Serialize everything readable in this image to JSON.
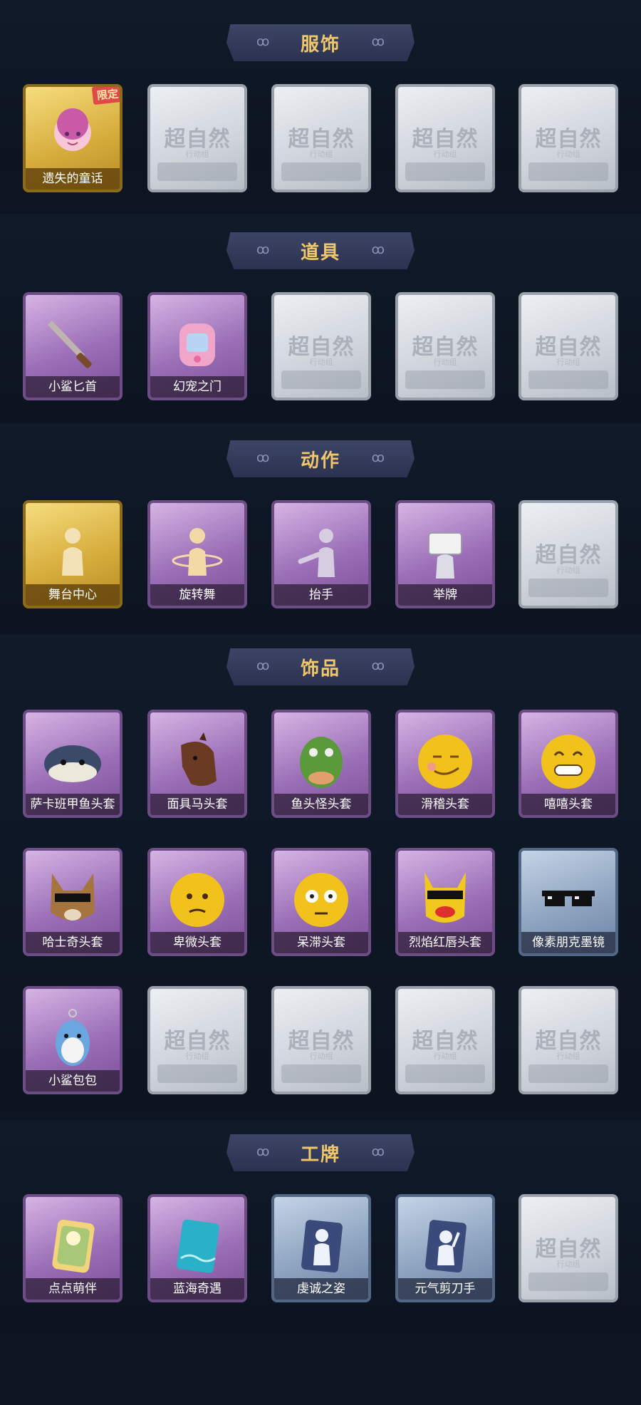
{
  "sections": [
    {
      "title": "服饰",
      "items": [
        {
          "label": "遗失的童话",
          "type": "gold",
          "badge": "限定"
        },
        {
          "empty": true
        },
        {
          "empty": true
        },
        {
          "empty": true
        },
        {
          "empty": true
        }
      ]
    },
    {
      "title": "道具",
      "items": [
        {
          "label": "小鲨匕首",
          "type": "purple"
        },
        {
          "label": "幻宠之门",
          "type": "purple"
        },
        {
          "empty": true
        },
        {
          "empty": true
        },
        {
          "empty": true
        }
      ]
    },
    {
      "title": "动作",
      "items": [
        {
          "label": "舞台中心",
          "type": "gold"
        },
        {
          "label": "旋转舞",
          "type": "purple"
        },
        {
          "label": "抬手",
          "type": "purple"
        },
        {
          "label": "举牌",
          "type": "purple"
        },
        {
          "empty": true
        }
      ]
    },
    {
      "title": "饰品",
      "items": [
        {
          "label": "萨卡班甲鱼头套",
          "type": "purple"
        },
        {
          "label": "面具马头套",
          "type": "purple"
        },
        {
          "label": "鱼头怪头套",
          "type": "purple"
        },
        {
          "label": "滑稽头套",
          "type": "purple"
        },
        {
          "label": "嘻嘻头套",
          "type": "purple"
        },
        {
          "label": "哈士奇头套",
          "type": "purple"
        },
        {
          "label": "卑微头套",
          "type": "purple"
        },
        {
          "label": "呆滞头套",
          "type": "purple"
        },
        {
          "label": "烈焰红唇头套",
          "type": "purple"
        },
        {
          "label": "像素朋克墨镜",
          "type": "blue"
        },
        {
          "label": "小鲨包包",
          "type": "purple"
        },
        {
          "empty": true
        },
        {
          "empty": true
        },
        {
          "empty": true
        },
        {
          "empty": true
        }
      ]
    },
    {
      "title": "工牌",
      "items": [
        {
          "label": "点点萌伴",
          "type": "purple"
        },
        {
          "label": "蓝海奇遇",
          "type": "purple"
        },
        {
          "label": "虔诚之姿",
          "type": "blue"
        },
        {
          "label": "元气剪刀手",
          "type": "blue"
        },
        {
          "empty": true
        }
      ]
    }
  ],
  "empty_logo": {
    "title": "超自然",
    "subtitle": "行动组"
  },
  "colors": {
    "background": "#0d1522",
    "title_text": "#f0c76a",
    "plate": "#343b5b"
  }
}
